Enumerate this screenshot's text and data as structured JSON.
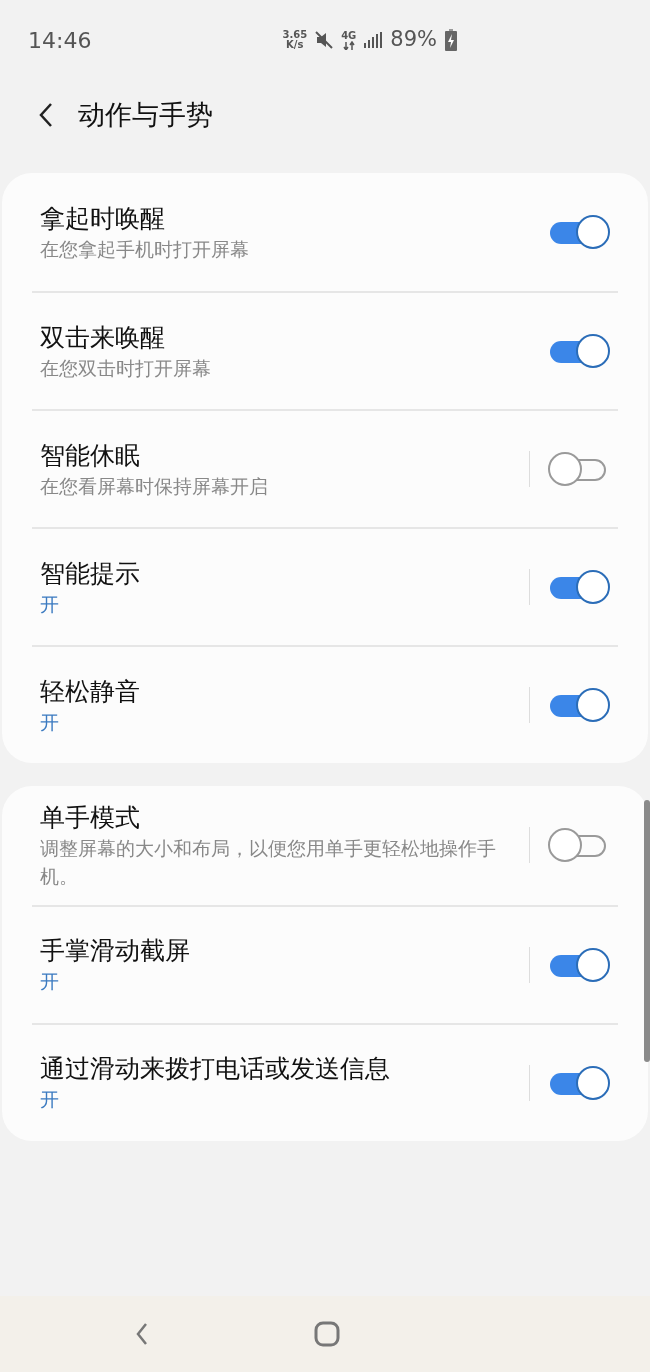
{
  "status_bar": {
    "time": "14:46",
    "speed_value": "3.65",
    "speed_unit": "K/s",
    "network": "4G",
    "battery": "89%"
  },
  "header": {
    "title": "动作与手势"
  },
  "groups": [
    {
      "rows": [
        {
          "title": "拿起时唤醒",
          "summary": "在您拿起手机时打开屏幕",
          "kind": "description",
          "divider": false,
          "on": true
        },
        {
          "title": "双击来唤醒",
          "summary": "在您双击时打开屏幕",
          "kind": "description",
          "divider": false,
          "on": true
        },
        {
          "title": "智能休眠",
          "summary": "在您看屏幕时保持屏幕开启",
          "kind": "description",
          "divider": true,
          "on": false
        },
        {
          "title": "智能提示",
          "summary": "开",
          "kind": "status",
          "divider": true,
          "on": true
        },
        {
          "title": "轻松静音",
          "summary": "开",
          "kind": "status",
          "divider": true,
          "on": true
        }
      ]
    },
    {
      "rows": [
        {
          "title": "单手模式",
          "summary": "调整屏幕的大小和布局，以便您用单手更轻松地操作手机。",
          "kind": "description",
          "divider": true,
          "on": false
        },
        {
          "title": "手掌滑动截屏",
          "summary": "开",
          "kind": "status",
          "divider": true,
          "on": true
        },
        {
          "title": "通过滑动来拨打电话或发送信息",
          "summary": "开",
          "kind": "status",
          "divider": true,
          "on": true
        }
      ]
    }
  ]
}
